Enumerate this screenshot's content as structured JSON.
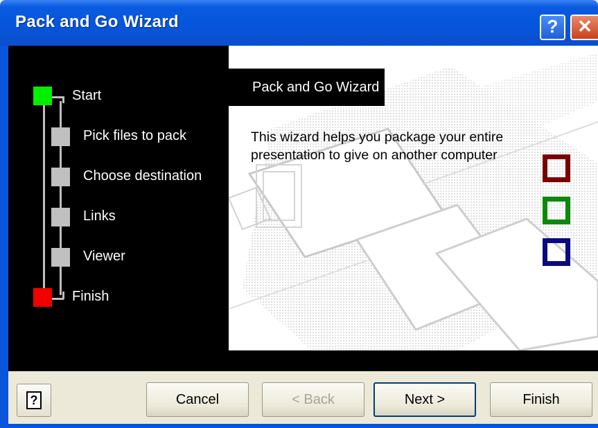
{
  "window": {
    "title": "Pack and Go Wizard",
    "help_button": "?",
    "close_button": "✕"
  },
  "steps": [
    {
      "label": "Start",
      "state": "current",
      "color": "#00f000"
    },
    {
      "label": "Pick files to pack",
      "state": "pending",
      "color": "#c0c0c0"
    },
    {
      "label": "Choose destination",
      "state": "pending",
      "color": "#c0c0c0"
    },
    {
      "label": "Links",
      "state": "pending",
      "color": "#c0c0c0"
    },
    {
      "label": "Viewer",
      "state": "pending",
      "color": "#c0c0c0"
    },
    {
      "label": "Finish",
      "state": "end",
      "color": "#f00000"
    }
  ],
  "content": {
    "banner": "Pack and Go Wizard",
    "description_line1": "This wizard helps you package your entire",
    "description_line2": "presentation to give on another computer"
  },
  "buttons": {
    "help_glyph": "?",
    "cancel": "Cancel",
    "back": "< Back",
    "next": "Next >",
    "finish": "Finish"
  },
  "colors": {
    "titlebar": "#0656dc",
    "square_red": "#7a0000",
    "square_green": "#0a8a0a",
    "square_blue": "#0a0a80"
  }
}
